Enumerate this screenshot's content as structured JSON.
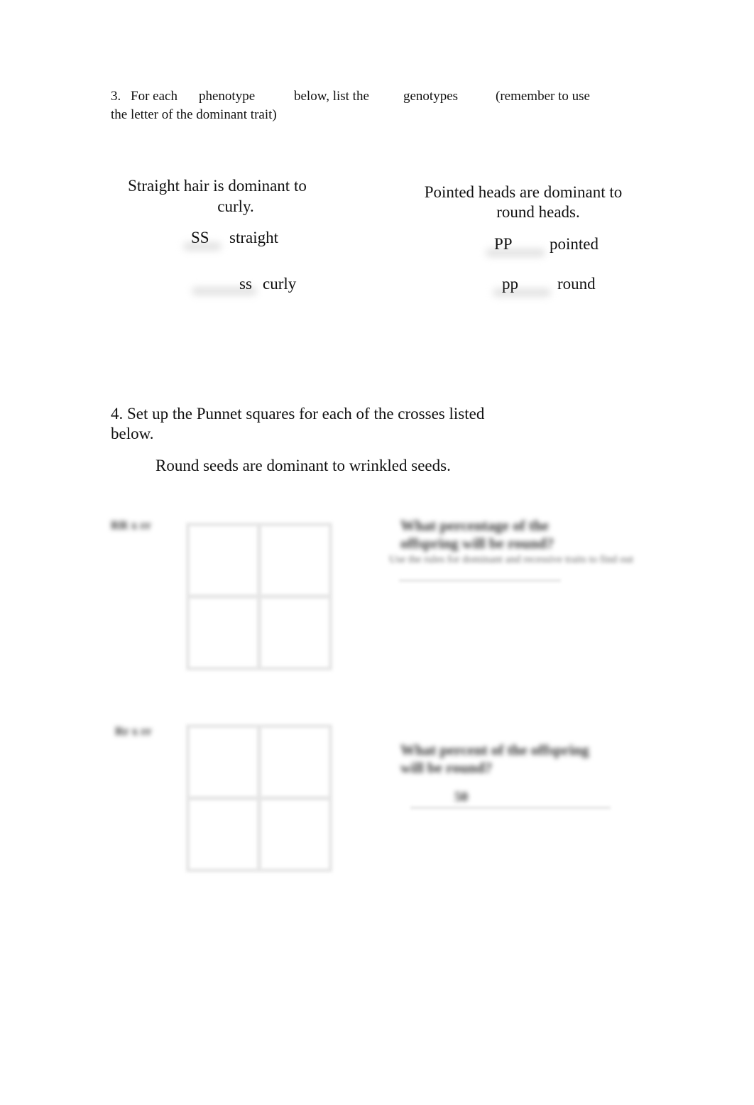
{
  "question3": {
    "line1": {
      "number": "3.",
      "part1": "For each",
      "part2": "phenotype",
      "part3": "below, list the",
      "part4": "genotypes",
      "part5": "(remember to use"
    },
    "line2": "the letter of the dominant trait)",
    "left_block": {
      "title_line1": "Straight hair is dominant to",
      "title_line2": "curly.",
      "rows": [
        {
          "genotype": "SS",
          "phenotype": "straight"
        },
        {
          "genotype": "ss",
          "phenotype": "curly"
        }
      ]
    },
    "right_block": {
      "title_line1": "Pointed heads are dominant to",
      "title_line2": "round heads.",
      "rows": [
        {
          "genotype": "PP",
          "phenotype": "pointed"
        },
        {
          "genotype": "pp",
          "phenotype": "round"
        }
      ]
    }
  },
  "question4": {
    "line1": "4.  Set up the Punnet squares for each of the crosses listed",
    "line2": "below.",
    "subtitle": "Round seeds are dominant to wrinkled seeds.",
    "crosses": [
      {
        "label": "RR x rr",
        "question_line1": "What percentage of the",
        "question_line2": "offspring will be round?",
        "note": "Use the rules for dominant and recessive traits to find out",
        "answer": ""
      },
      {
        "label": "Rr x rr",
        "question_line1": "What percent of the offspring",
        "question_line2": "will be round?",
        "answer": "50"
      }
    ]
  }
}
